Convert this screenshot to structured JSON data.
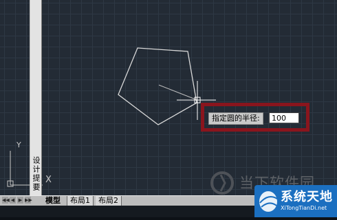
{
  "left_palette": {
    "label": "设计提要"
  },
  "ucs": {
    "x_label": "X",
    "y_label": "Y"
  },
  "prompt": {
    "label": "指定圆的半径:",
    "value": "100"
  },
  "tabs": [
    {
      "label": "模型",
      "active": true
    },
    {
      "label": "布局1",
      "active": false
    },
    {
      "label": "布局2",
      "active": false
    }
  ],
  "nav_buttons": [
    "◀◀",
    "◀",
    "▶",
    "▶▶"
  ],
  "watermark": {
    "text": "当下软件园"
  },
  "logo": {
    "name": "系统天地",
    "url": "XiTongTianDi.net"
  },
  "colors": {
    "canvas": "#232b35",
    "highlight_box": "#8a151d",
    "logo_blue": "#1b6fc0"
  }
}
